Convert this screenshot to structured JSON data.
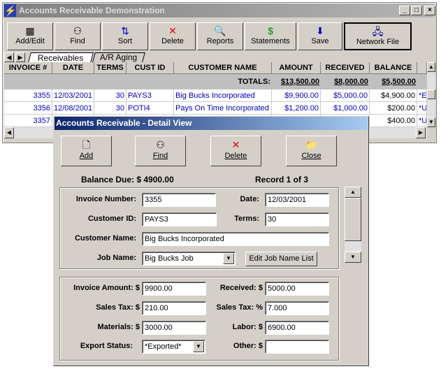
{
  "window": {
    "title": "Accounts Receivable Demonstration",
    "minimize": "_",
    "maximize": "□",
    "close": "×"
  },
  "toolbar": [
    {
      "label": "Add/Edit",
      "icon": "▦",
      "name": "add-edit"
    },
    {
      "label": "Find",
      "icon": "⚇",
      "name": "find"
    },
    {
      "label": "Sort",
      "icon": "⇅",
      "name": "sort"
    },
    {
      "label": "Delete",
      "icon": "✕",
      "name": "delete"
    },
    {
      "label": "Reports",
      "icon": "🔍",
      "name": "reports"
    },
    {
      "label": "Statements",
      "icon": "$",
      "name": "statements"
    },
    {
      "label": "Save",
      "icon": "⬇",
      "name": "save"
    },
    {
      "label": "Network File",
      "icon": "🖧",
      "name": "network-file"
    }
  ],
  "tabs": [
    {
      "label": "Receivables"
    },
    {
      "label": "A/R Aging"
    }
  ],
  "grid": {
    "columns": [
      "INVOICE #",
      "DATE",
      "TERMS",
      "CUST ID",
      "CUSTOMER NAME",
      "AMOUNT",
      "RECEIVED",
      "BALANCE",
      ""
    ],
    "totals_label": "TOTALS:",
    "totals": [
      "$13,500.00",
      "$8,000.00",
      "$5,500.00"
    ],
    "rows": [
      [
        "3355",
        "12/03/2001",
        "30",
        "PAYS3",
        "Big Bucks Incorporated",
        "$9,900.00",
        "$5,000.00",
        "$4,900.00",
        "*Ex"
      ],
      [
        "3356",
        "12/08/2001",
        "30",
        "POTI4",
        "Pays On Time Incorporated",
        "$1,200.00",
        "$1,000.00",
        "$200.00",
        "*Un"
      ],
      [
        "3357",
        "",
        "",
        "",
        "",
        "",
        "",
        "$400.00",
        "*Un"
      ]
    ]
  },
  "detail": {
    "title": "Accounts Receivable - Detail View",
    "buttons": [
      {
        "label": "Add",
        "icon": "🗋"
      },
      {
        "label": "Find",
        "icon": "⚇"
      },
      {
        "label": "Delete",
        "icon": "✕"
      },
      {
        "label": "Close",
        "icon": "📁"
      }
    ],
    "balance_due": "Balance Due: $ 4900.00",
    "record": "Record 1 of 3",
    "labels": {
      "invoice_number": "Invoice Number:",
      "date": "Date:",
      "customer_id": "Customer ID:",
      "terms": "Terms:",
      "customer_name": "Customer Name:",
      "job_name": "Job Name:",
      "invoice_amount": "Invoice Amount: $",
      "received": "Received: $",
      "sales_tax": "Sales Tax: $",
      "sales_tax_pct": "Sales Tax: %",
      "materials": "Materials: $",
      "labor": "Labor: $",
      "export_status": "Export Status:",
      "other": "Other: $"
    },
    "values": {
      "invoice_number": "3355",
      "date": "12/03/2001",
      "customer_id": "PAYS3",
      "terms": "30",
      "customer_name": "Big Bucks Incorporated",
      "job_name": "Big Bucks Job",
      "invoice_amount": "9900.00",
      "received": "5000.00",
      "sales_tax": "210.00",
      "sales_tax_pct": "7.000",
      "materials": "3000.00",
      "labor": "6900.00",
      "export_status": "*Exported*",
      "other": ""
    },
    "edit_job_list": "Edit Job Name List"
  }
}
